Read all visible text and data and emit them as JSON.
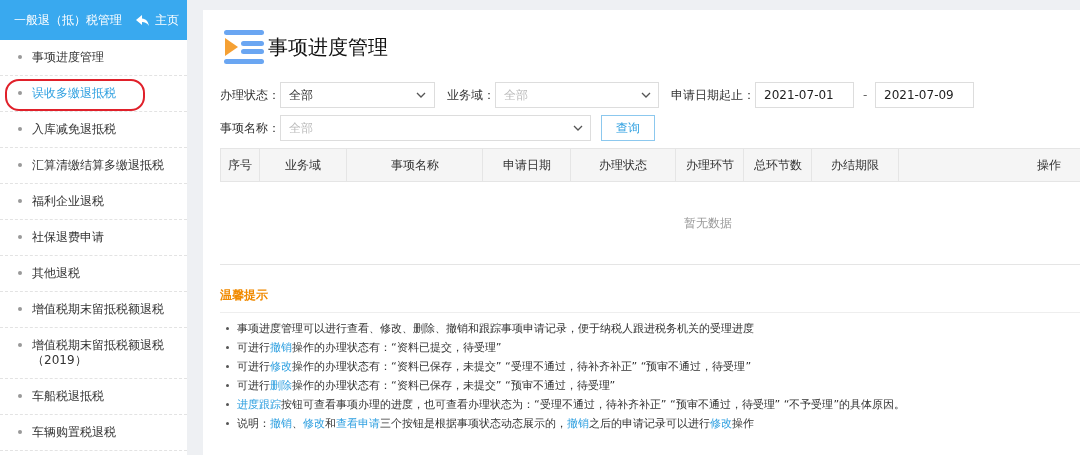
{
  "sidebar": {
    "title": "一般退（抵）税管理",
    "home_link": "主页",
    "items": [
      {
        "label": "事项进度管理",
        "selected": false,
        "circled": false
      },
      {
        "label": "误收多缴退抵税",
        "selected": true,
        "circled": true
      },
      {
        "label": "入库减免退抵税",
        "selected": false,
        "circled": false
      },
      {
        "label": "汇算清缴结算多缴退抵税",
        "selected": false,
        "circled": false
      },
      {
        "label": "福利企业退税",
        "selected": false,
        "circled": false
      },
      {
        "label": "社保退费申请",
        "selected": false,
        "circled": false
      },
      {
        "label": "其他退税",
        "selected": false,
        "circled": false
      },
      {
        "label": "增值税期末留抵税额退税",
        "selected": false,
        "circled": false
      },
      {
        "label": "增值税期末留抵税额退税（2019）",
        "selected": false,
        "circled": false
      },
      {
        "label": "车船税退抵税",
        "selected": false,
        "circled": false
      },
      {
        "label": "车辆购置税退税",
        "selected": false,
        "circled": false
      }
    ]
  },
  "page_title": "事项进度管理",
  "filters": {
    "status": {
      "label": "办理状态：",
      "value": "全部"
    },
    "domain": {
      "label": "业务域：",
      "placeholder": "全部"
    },
    "date_range": {
      "label": "申请日期起止：",
      "start": "2021-07-01",
      "separator": "-",
      "end": "2021-07-09"
    },
    "item_name": {
      "label": "事项名称：",
      "placeholder": "全部"
    },
    "query_button": "查询"
  },
  "table": {
    "columns": [
      "序号",
      "业务域",
      "事项名称",
      "申请日期",
      "办理状态",
      "办理环节",
      "总环节数",
      "办结期限",
      "操作"
    ],
    "empty_text": "暂无数据"
  },
  "tips": {
    "title": "温馨提示",
    "items": [
      [
        {
          "text": "事项进度管理可以进行查看、修改、删除、撤销和跟踪事项申请记录，便于纳税人跟进税务机关的受理进度",
          "link": false
        }
      ],
      [
        {
          "text": "可进行",
          "link": false
        },
        {
          "text": "撤销",
          "link": true
        },
        {
          "text": "操作的办理状态有：“资料已提交，待受理”",
          "link": false
        }
      ],
      [
        {
          "text": "可进行",
          "link": false
        },
        {
          "text": "修改",
          "link": true
        },
        {
          "text": "操作的办理状态有：“资料已保存，未提交” “受理不通过，待补齐补正” “预审不通过，待受理”",
          "link": false
        }
      ],
      [
        {
          "text": "可进行",
          "link": false
        },
        {
          "text": "删除",
          "link": true
        },
        {
          "text": "操作的办理状态有：“资料已保存，未提交” “预审不通过，待受理”",
          "link": false
        }
      ],
      [
        {
          "text": "进度跟踪",
          "link": true
        },
        {
          "text": "按钮可查看事项办理的进度，也可查看办理状态为：“受理不通过，待补齐补正” “预审不通过，待受理” “不予受理”的具体原因。",
          "link": false
        }
      ],
      [
        {
          "text": "说明：",
          "link": false
        },
        {
          "text": "撤销",
          "link": true
        },
        {
          "text": "、",
          "link": false
        },
        {
          "text": "修改",
          "link": true
        },
        {
          "text": "和",
          "link": false
        },
        {
          "text": "查看申请",
          "link": true
        },
        {
          "text": "三个按钮是根据事项状态动态展示的，",
          "link": false
        },
        {
          "text": "撤销",
          "link": true
        },
        {
          "text": "之后的申请记录可以进行",
          "link": false
        },
        {
          "text": "修改",
          "link": true
        },
        {
          "text": "操作",
          "link": false
        }
      ]
    ]
  }
}
